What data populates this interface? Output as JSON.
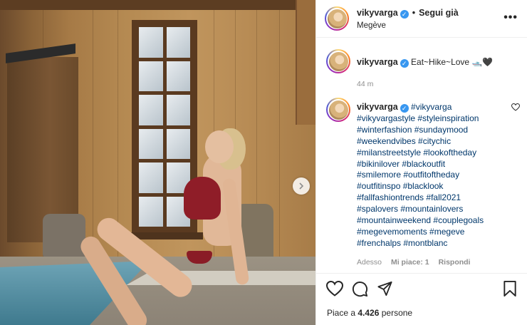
{
  "post": {
    "username": "vikyvarga",
    "follow_status": "Segui già",
    "location": "Megève",
    "more_label": "•••"
  },
  "caption": {
    "username": "vikyvarga",
    "text": "Eat~Hike~Love 🛥️🖤",
    "time": "44 m"
  },
  "comment": {
    "username": "vikyvarga",
    "first_tag": "#vikyvarga",
    "hashtags": [
      "#vikyvargastyle #styleinspiration",
      "#winterfashion #sundaymood",
      "#weekendvibes #citychic",
      "#milanstreetstyle #lookoftheday",
      "#bikinilover #blackoutfit",
      "#smilemore #outfitoftheday",
      "#outfitinspo #blacklook",
      "#fallfashiontrends #fall2021",
      "#spalovers #mountainlovers",
      "#mountainweekend #couplegoals",
      "#megevemoments #megeve",
      "#frenchalps #montblanc"
    ],
    "ago": "Adesso",
    "likes_label": "Mi piace: 1",
    "reply_label": "Rispondi"
  },
  "likes": {
    "prefix": "Piace a ",
    "count": "4.426",
    "suffix": " persone"
  },
  "icons": {
    "like": "heart-icon",
    "comment": "comment-icon",
    "share": "paper-plane-icon",
    "save": "bookmark-icon",
    "next": "chevron-right-icon"
  },
  "colors": {
    "verified": "#3897f0",
    "hashtag": "#00376b",
    "muted": "#8e8e8e",
    "text": "#262626"
  }
}
